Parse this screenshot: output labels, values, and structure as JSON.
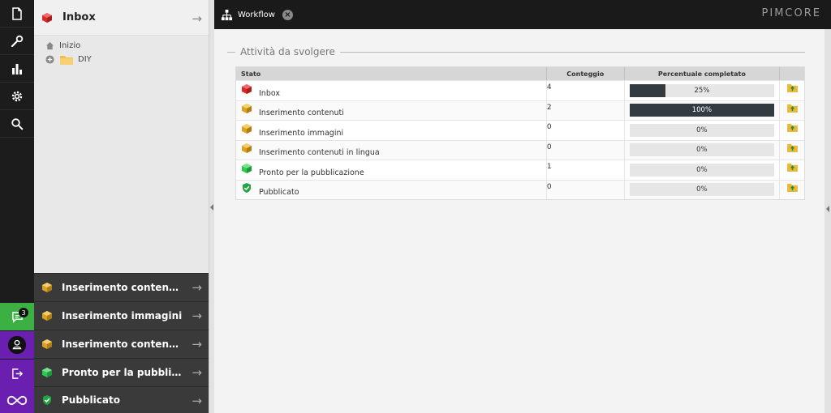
{
  "colors": {
    "rail_bg": "#1c1c1c",
    "chat_green": "#3cb043",
    "purple": "#6b1fb1",
    "progress_fill": "#333a40",
    "cube_red": "#d62a2a",
    "cube_gold": "#d9a227",
    "cube_green": "#2fc850"
  },
  "rail": {
    "top_icons": [
      "document-icon",
      "wrench-icon",
      "bar-chart-icon",
      "gear-icon",
      "search-icon"
    ],
    "notification_count": "3"
  },
  "tree_panel": {
    "title": "Inbox",
    "items": [
      {
        "label": "Inizio",
        "icon": "home-icon"
      },
      {
        "label": "DIY",
        "icon": "folder-icon"
      }
    ]
  },
  "accordion": [
    {
      "label": "Inserimento contenuti",
      "icon": "gold-cube-icon"
    },
    {
      "label": "Inserimento immagini",
      "icon": "gold-cube-icon"
    },
    {
      "label": "Inserimento contenuti in lingua",
      "icon": "gold-cube-icon"
    },
    {
      "label": "Pronto per la pubblicazione",
      "icon": "green-cube-icon"
    },
    {
      "label": "Pubblicato",
      "icon": "check-shield-icon"
    }
  ],
  "tabbar": {
    "tab_label": "Workflow",
    "logo": "PIMCORE"
  },
  "main": {
    "fieldset_title": "Attività da svolgere",
    "columns": {
      "stato": "Stato",
      "conteggio": "Conteggio",
      "percentuale": "Percentuale completato"
    },
    "rows": [
      {
        "stato": "Inbox",
        "icon": "red-cube-icon",
        "count": "4",
        "percent": 25,
        "percent_label": "25%"
      },
      {
        "stato": "Inserimento contenuti",
        "icon": "gold-cube-icon",
        "count": "2",
        "percent": 100,
        "percent_label": "100%"
      },
      {
        "stato": "Inserimento immagini",
        "icon": "gold-cube-icon",
        "count": "0",
        "percent": 0,
        "percent_label": "0%"
      },
      {
        "stato": "Inserimento contenuti in lingua",
        "icon": "gold-cube-icon",
        "count": "0",
        "percent": 0,
        "percent_label": "0%"
      },
      {
        "stato": "Pronto per la pubblicazione",
        "icon": "green-cube-icon",
        "count": "1",
        "percent": 0,
        "percent_label": "0%"
      },
      {
        "stato": "Pubblicato",
        "icon": "check-shield-icon",
        "count": "0",
        "percent": 0,
        "percent_label": "0%"
      }
    ]
  }
}
